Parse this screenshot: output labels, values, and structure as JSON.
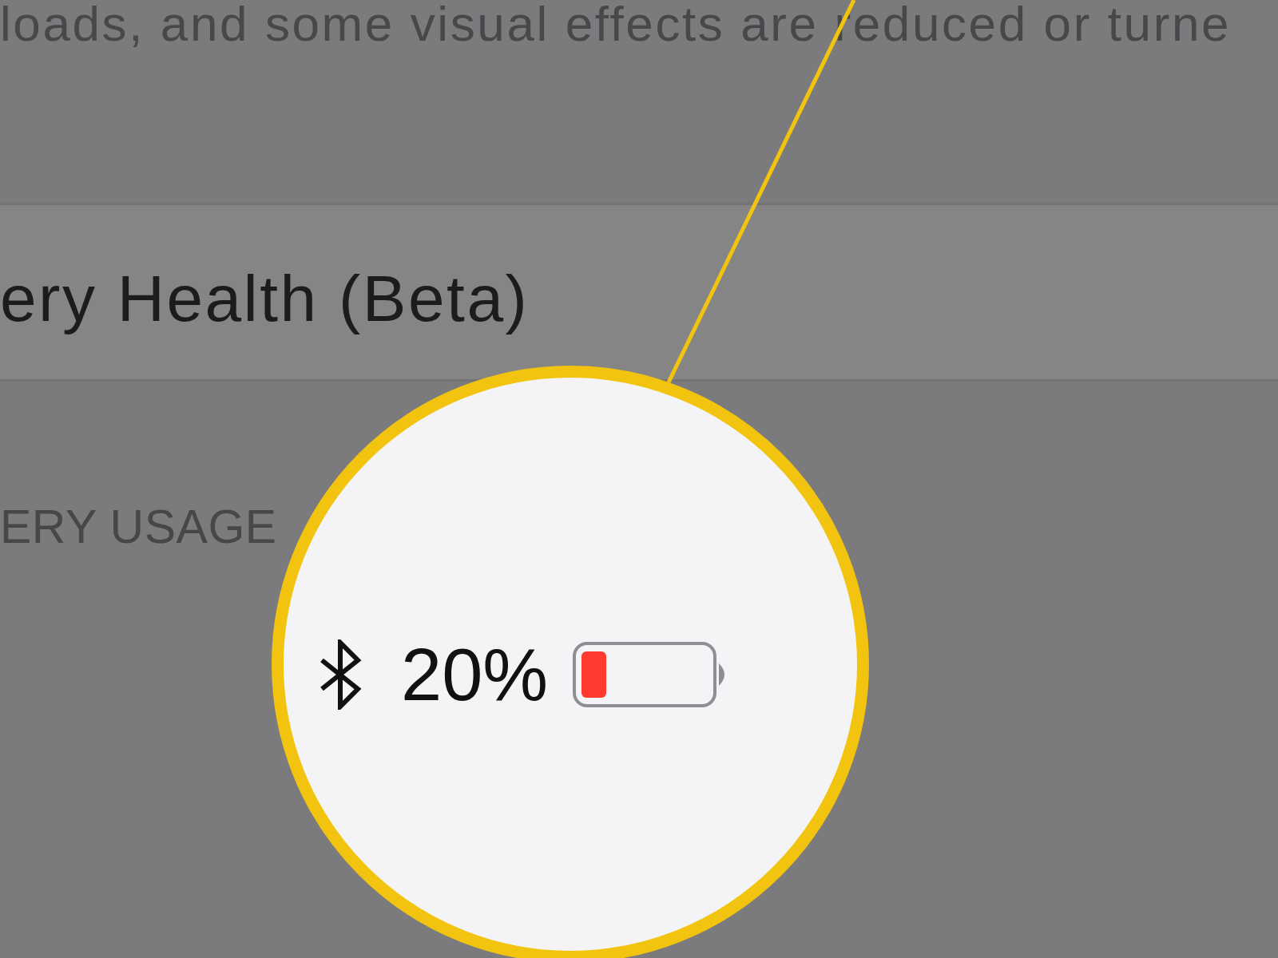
{
  "description": {
    "text": "loads, and some visual effects are reduced or turne"
  },
  "settings_row": {
    "label": "ery Health (Beta)"
  },
  "section_header": {
    "text": "ERY USAGE"
  },
  "magnifier": {
    "battery_percentage": "20%"
  }
}
